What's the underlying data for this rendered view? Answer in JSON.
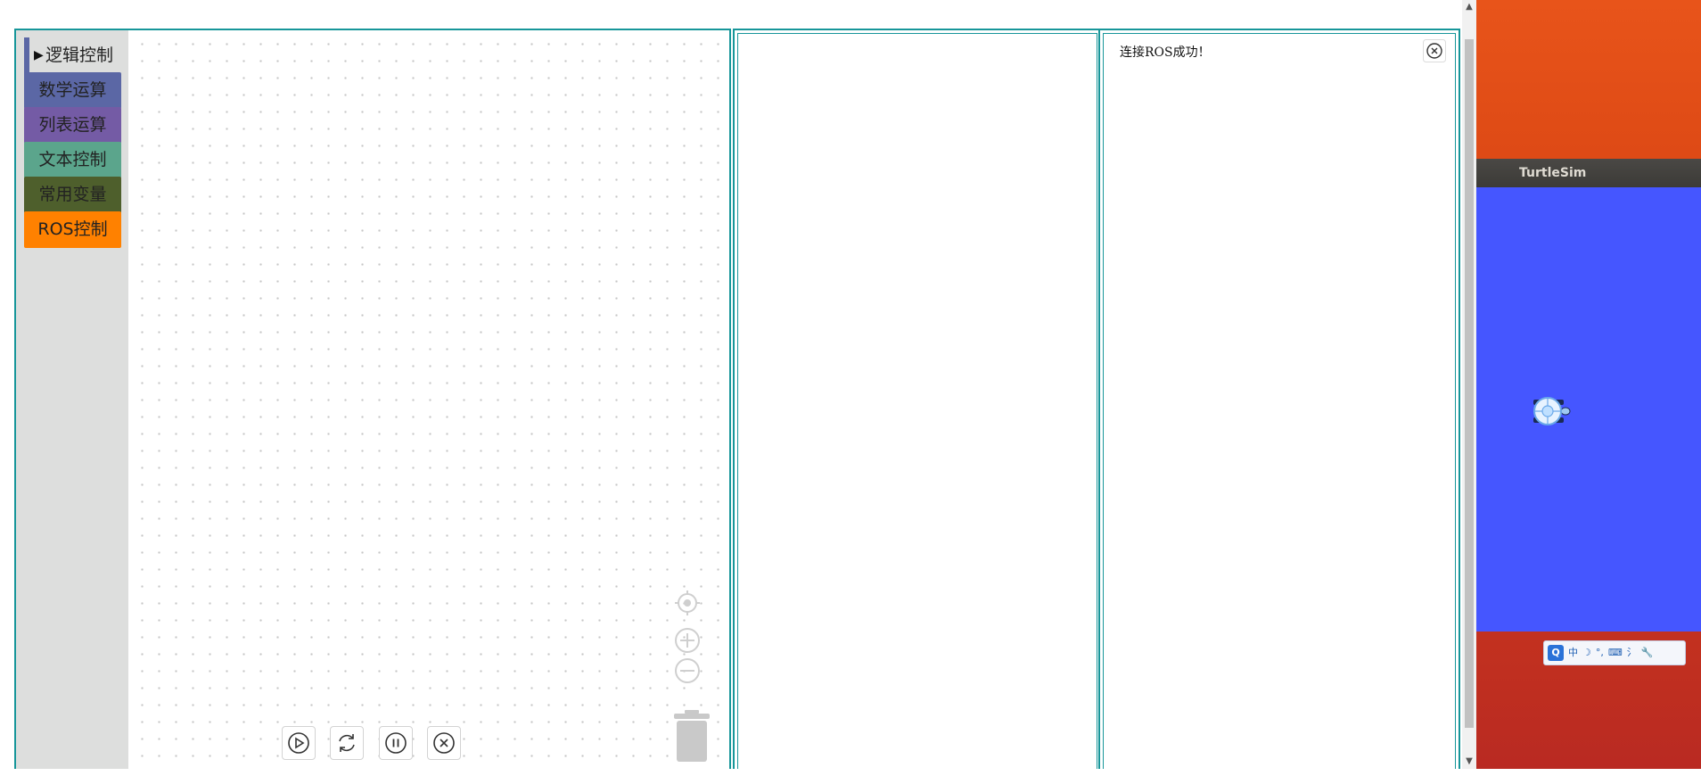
{
  "toolbox": {
    "categories": [
      {
        "label": "逻辑控制",
        "color": "#5b67a5",
        "selected": true
      },
      {
        "label": "数学运算",
        "color": "#5b67a5"
      },
      {
        "label": "列表运算",
        "color": "#745ba5"
      },
      {
        "label": "文本控制",
        "color": "#5ba58c"
      },
      {
        "label": "常用变量",
        "color": "#4e5f2c"
      },
      {
        "label": "ROS控制",
        "color": "#ff8100"
      }
    ]
  },
  "workspace_controls": {
    "zoom": [
      "recenter-icon",
      "zoom-in-icon",
      "zoom-out-icon"
    ],
    "trash": "trash-icon",
    "run_buttons": [
      "play-icon",
      "refresh-icon",
      "pause-icon",
      "stop-icon"
    ]
  },
  "console": {
    "message": "连接ROS成功！"
  },
  "turtlesim": {
    "title": "TurtleSim",
    "background": "#4556ff"
  },
  "tray": {
    "items": [
      "Q",
      "中",
      "☽",
      "°,",
      "⌨",
      "⺡",
      "🔧"
    ]
  },
  "colors": {
    "panel_border": "#17969a",
    "toolbox_bg": "#dddedd"
  }
}
